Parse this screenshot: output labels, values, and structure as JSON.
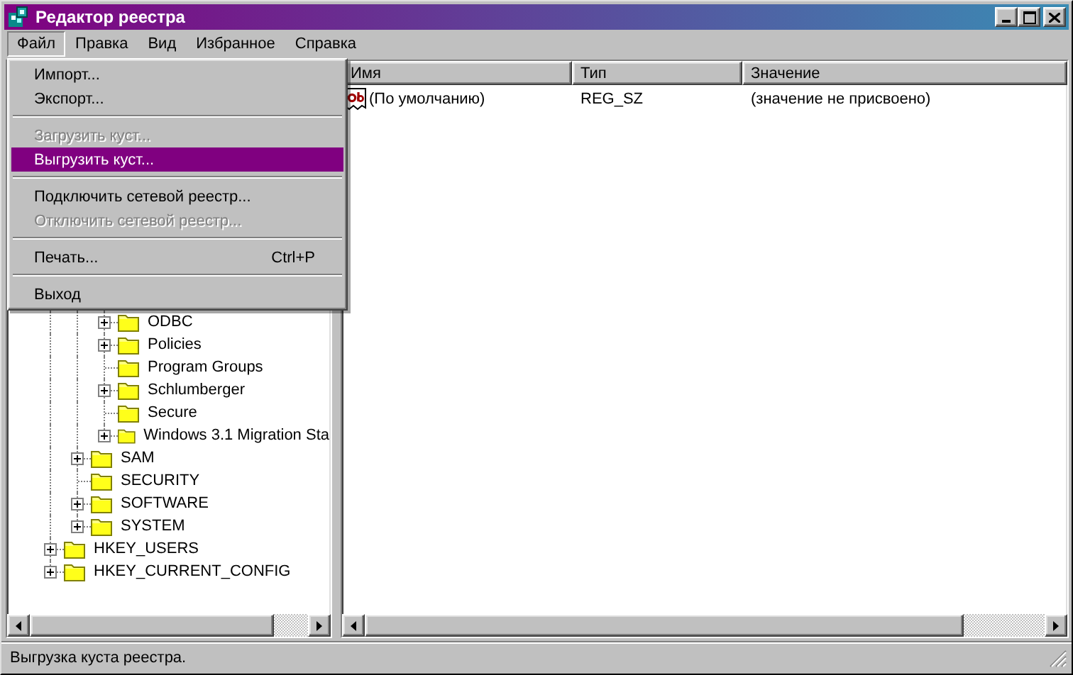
{
  "window": {
    "title": "Редактор реестра"
  },
  "menu": [
    {
      "label": "Файл",
      "selected": true
    },
    {
      "label": "Правка",
      "selected": false
    },
    {
      "label": "Вид",
      "selected": false
    },
    {
      "label": "Избранное",
      "selected": false
    },
    {
      "label": "Справка",
      "selected": false
    }
  ],
  "file_menu": {
    "items": [
      {
        "kind": "item",
        "label": "Импорт...",
        "disabled": false,
        "selected": false
      },
      {
        "kind": "item",
        "label": "Экспорт...",
        "disabled": false,
        "selected": false
      },
      {
        "kind": "separator"
      },
      {
        "kind": "item",
        "label": "Загрузить куст...",
        "disabled": true,
        "selected": false
      },
      {
        "kind": "item",
        "label": "Выгрузить куст...",
        "disabled": false,
        "selected": true
      },
      {
        "kind": "separator"
      },
      {
        "kind": "item",
        "label": "Подключить сетевой реестр...",
        "disabled": false,
        "selected": false
      },
      {
        "kind": "item",
        "label": "Отключить сетевой реестр...",
        "disabled": true,
        "selected": false
      },
      {
        "kind": "separator"
      },
      {
        "kind": "item",
        "label": "Печать...",
        "shortcut": "Ctrl+P",
        "disabled": false,
        "selected": false
      },
      {
        "kind": "separator"
      },
      {
        "kind": "item",
        "label": "Выход",
        "disabled": false,
        "selected": false
      }
    ]
  },
  "tree": [
    {
      "children": [
        {
          "children": [
            {
              "children": [
                {
                  "label": "ODBC",
                  "expanded": false
                },
                {
                  "label": "Policies",
                  "expanded": false
                },
                {
                  "label": "Program Groups"
                },
                {
                  "label": "Schlumberger",
                  "expanded": false
                },
                {
                  "label": "Secure"
                },
                {
                  "label": "Windows 3.1 Migration Sta",
                  "expanded": false
                }
              ]
            },
            {
              "label": "SAM",
              "expanded": false
            },
            {
              "label": "SECURITY"
            },
            {
              "label": "SOFTWARE",
              "expanded": false
            },
            {
              "label": "SYSTEM",
              "expanded": false
            }
          ]
        },
        {
          "label": "HKEY_USERS",
          "expanded": false
        },
        {
          "label": "HKEY_CURRENT_CONFIG",
          "expanded": false
        }
      ]
    }
  ],
  "list": {
    "columns": [
      "Имя",
      "Тип",
      "Значение"
    ],
    "rows": [
      {
        "name": "(По умолчанию)",
        "type": "REG_SZ",
        "value": "(значение не присвоено)"
      }
    ]
  },
  "status_bar": "Выгрузка куста реестра."
}
